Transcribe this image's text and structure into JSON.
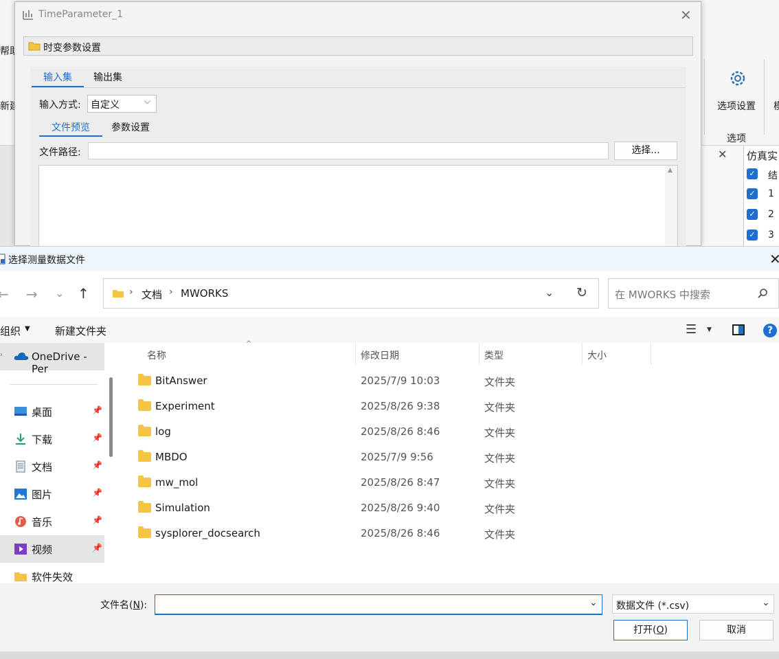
{
  "background_app": {
    "help_label": "帮助",
    "new_label": "新建",
    "options_settings_label": "选项设置",
    "options_group_label": "选项",
    "right_edge_label": "模",
    "sim_panel_title": "仿真实",
    "sim_panel_header": "结",
    "sim_rows": [
      "1",
      "2",
      "3"
    ]
  },
  "time_parameter": {
    "title": "TimeParameter_1",
    "section_title": "时变参数设置",
    "tabs": [
      "输入集",
      "输出集"
    ],
    "input_mode_label": "输入方式:",
    "input_mode_value": "自定义",
    "subtabs": [
      "文件预览",
      "参数设置"
    ],
    "file_path_label": "文件路径:",
    "file_path_value": "",
    "choose_button": "选择..."
  },
  "file_dialog": {
    "title": "选择测量数据文件",
    "breadcrumb": [
      "文档",
      "MWORKS"
    ],
    "search_placeholder": "在 MWORKS 中搜索",
    "organize_label": "组织",
    "new_folder_label": "新建文件夹",
    "sidebar": {
      "onedrive": "OneDrive - Per",
      "items": [
        {
          "label": "桌面",
          "icon": "desktop-icon"
        },
        {
          "label": "下载",
          "icon": "download-icon"
        },
        {
          "label": "文档",
          "icon": "document-icon"
        },
        {
          "label": "图片",
          "icon": "pictures-icon"
        },
        {
          "label": "音乐",
          "icon": "music-icon"
        },
        {
          "label": "视频",
          "icon": "video-icon"
        },
        {
          "label": "软件失效",
          "icon": "folder-icon"
        }
      ]
    },
    "columns": [
      "名称",
      "修改日期",
      "类型",
      "大小"
    ],
    "files": [
      {
        "name": "BitAnswer",
        "date": "2025/7/9 10:03",
        "type": "文件夹"
      },
      {
        "name": "Experiment",
        "date": "2025/8/26 9:38",
        "type": "文件夹"
      },
      {
        "name": "log",
        "date": "2025/8/26 8:46",
        "type": "文件夹"
      },
      {
        "name": "MBDO",
        "date": "2025/7/9 9:56",
        "type": "文件夹"
      },
      {
        "name": "mw_mol",
        "date": "2025/8/26 8:47",
        "type": "文件夹"
      },
      {
        "name": "Simulation",
        "date": "2025/8/26 9:40",
        "type": "文件夹"
      },
      {
        "name": "sysplorer_docsearch",
        "date": "2025/8/26 8:46",
        "type": "文件夹"
      }
    ],
    "filename_label_prefix": "文件名(",
    "filename_label_key": "N",
    "filename_label_suffix": "):",
    "filename_value": "",
    "filter_value": "数据文件 (*.csv)",
    "open_prefix": "打开(",
    "open_key": "O",
    "open_suffix": ")",
    "cancel_button": "取消"
  }
}
